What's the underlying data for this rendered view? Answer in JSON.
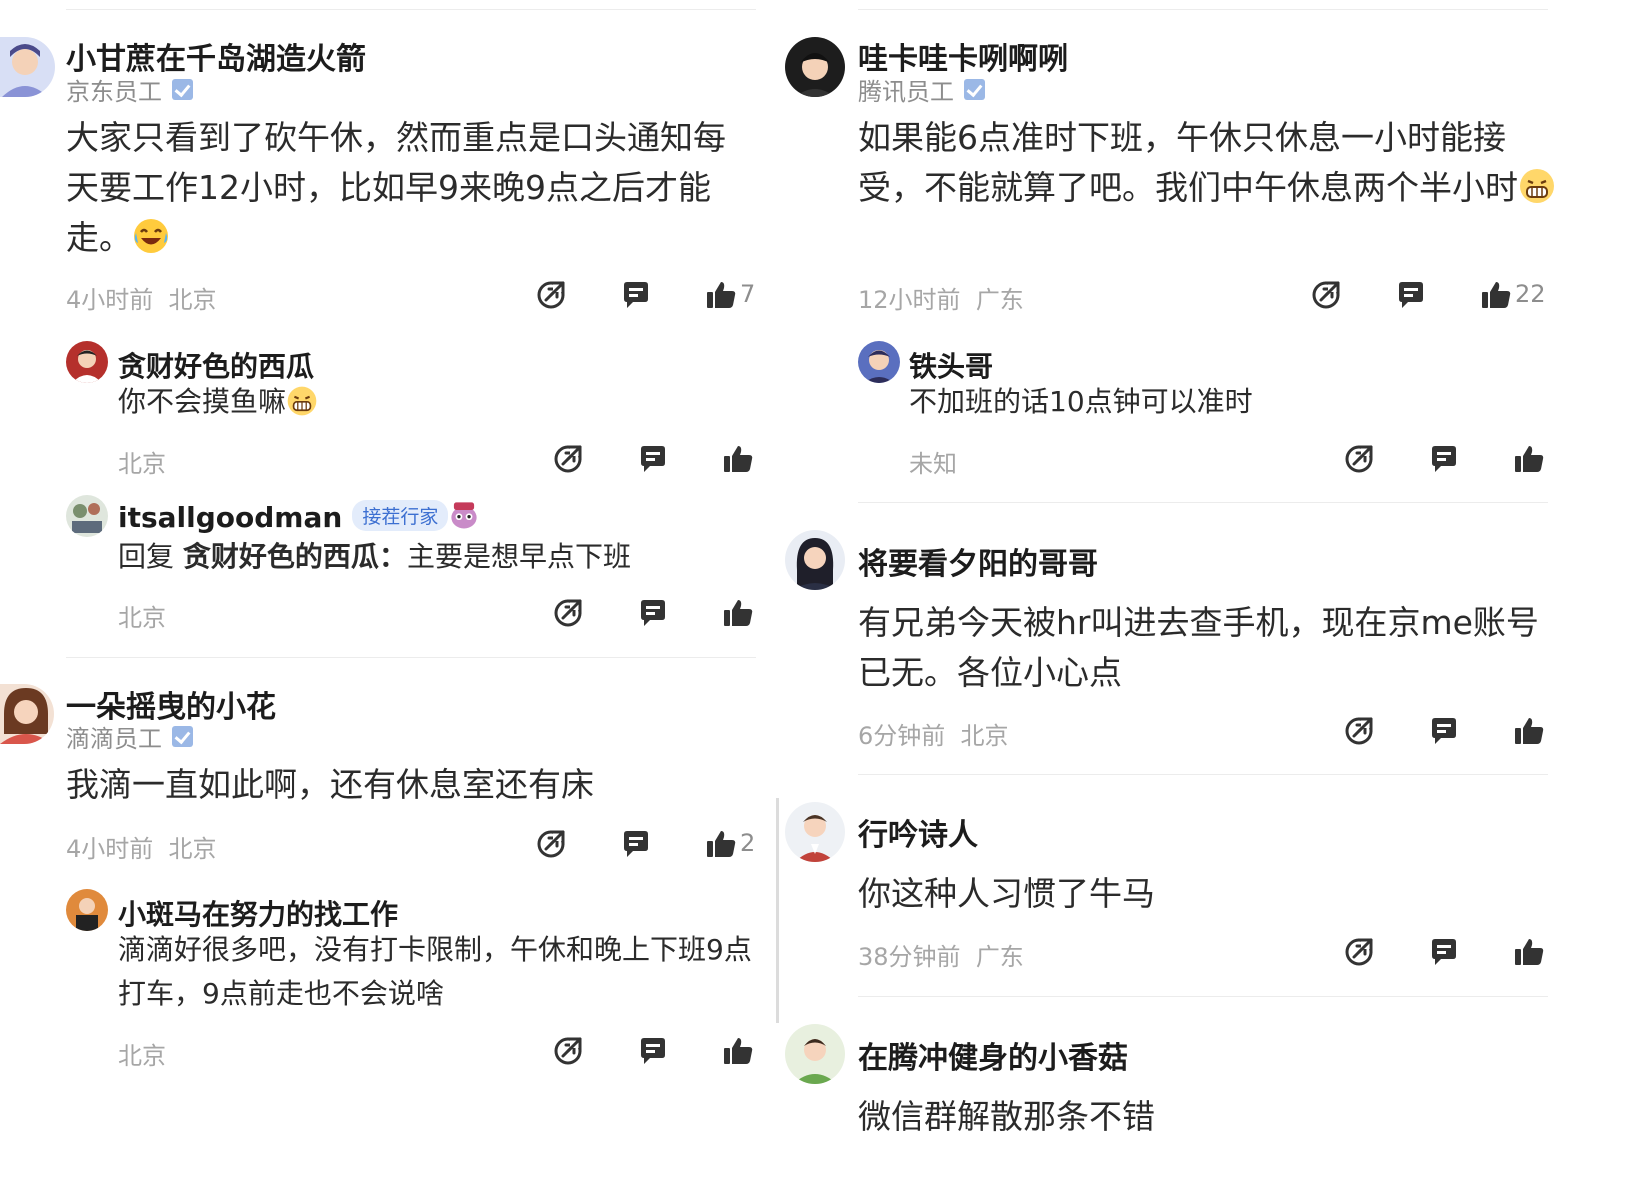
{
  "left": {
    "comment1": {
      "name": "小甘蔗在千岛湖造火箭",
      "company": "京东员工",
      "text": "大家只看到了砍午休，然而重点是口头通知每天要工作12小时，比如早9来晚9点之后才能走。",
      "time": "4小时前",
      "location": "北京",
      "likes": "7",
      "replies": [
        {
          "name": "贪财好色的西瓜",
          "text": "你不会摸鱼嘛",
          "location": "北京"
        },
        {
          "name": "itsallgoodman",
          "badge": "接茬行家",
          "reply_prefix": "回复",
          "reply_to": "贪财好色的西瓜：",
          "text": "主要是想早点下班",
          "location": "北京"
        }
      ]
    },
    "comment2": {
      "name": "一朵摇曳的小花",
      "company": "滴滴员工",
      "text": "我滴一直如此啊，还有休息室还有床",
      "time": "4小时前",
      "location": "北京",
      "likes": "2",
      "replies": [
        {
          "name": "小斑马在努力的找工作",
          "text": "滴滴好很多吧，没有打卡限制，午休和晚上下班9点打车，9点前走也不会说啥",
          "location": "北京"
        }
      ]
    }
  },
  "right": {
    "comment1": {
      "name": "哇卡哇卡咧啊咧",
      "company": "腾讯员工",
      "text": "如果能6点准时下班，午休只休息一小时能接受，不能就算了吧。我们中午休息两个半小时",
      "time": "12小时前",
      "location": "广东",
      "likes": "22",
      "replies": [
        {
          "name": "铁头哥",
          "text": "不加班的话10点钟可以准时",
          "location": "未知"
        }
      ]
    },
    "comment2": {
      "name": "将要看夕阳的哥哥",
      "text": "有兄弟今天被hr叫进去查手机，现在京me账号已无。各位小心点",
      "time": "6分钟前",
      "location": "北京"
    },
    "comment3": {
      "name": "行吟诗人",
      "text": "你这种人习惯了牛马",
      "time": "38分钟前",
      "location": "广东"
    },
    "comment4": {
      "name": "在腾冲健身的小香菇",
      "text": "微信群解散那条不错"
    }
  },
  "icons": {
    "share": "share-arrow-icon",
    "reply": "comment-icon",
    "like": "thumbs-up-icon",
    "verified": "verified-check-icon"
  },
  "colors": {
    "text_primary": "#1c1c1c",
    "text_meta": "#a6a6a6",
    "icon": "#333333",
    "verified_badge": "#9bb8e6",
    "divider": "#ececec"
  }
}
